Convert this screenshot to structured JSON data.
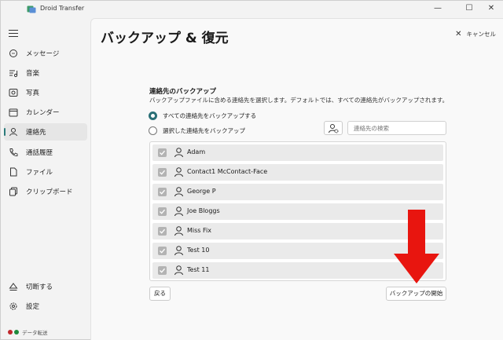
{
  "window": {
    "title": "Droid Transfer",
    "minimize_glyph": "—",
    "maximize_glyph": "☐",
    "close_glyph": "✕"
  },
  "sidebar": {
    "items": [
      {
        "label": "メッセージ",
        "icon": "message-icon"
      },
      {
        "label": "音楽",
        "icon": "music-icon"
      },
      {
        "label": "写真",
        "icon": "photo-icon"
      },
      {
        "label": "カレンダー",
        "icon": "calendar-icon"
      },
      {
        "label": "連絡先",
        "icon": "person-icon",
        "active": true
      },
      {
        "label": "通話履歴",
        "icon": "phone-icon"
      },
      {
        "label": "ファイル",
        "icon": "file-icon"
      },
      {
        "label": "クリップボード",
        "icon": "clipboard-icon"
      }
    ],
    "bottom": [
      {
        "label": "切断する",
        "icon": "eject-icon"
      },
      {
        "label": "設定",
        "icon": "gear-icon"
      }
    ],
    "status_text": "データ転送",
    "status_colors": [
      "#c0282d",
      "#1e8a3c"
    ]
  },
  "main": {
    "title": "バックアップ & 復元",
    "cancel_label": "キャンセル",
    "section_title": "連絡先のバックアップ",
    "section_desc": "バックアップファイルに含める連絡先を選択します。デフォルトでは、すべての連絡先がバックアップされます。",
    "radio_all": "すべての連絡先をバックアップする",
    "radio_selected": "選択した連絡先をバックアップ",
    "search_placeholder": "連絡先の検索",
    "contacts": [
      "Adam",
      "Contact1 McContact-Face",
      "George P",
      "Joe Bloggs",
      "Miss Fix",
      "Test 10",
      "Test 11"
    ],
    "back_label": "戻る",
    "start_label": "バックアップの開始"
  },
  "colors": {
    "accent": "#2a6f76",
    "annotation_arrow": "#e8150f"
  }
}
